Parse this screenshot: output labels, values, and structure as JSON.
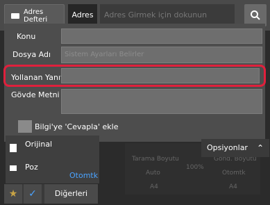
{
  "topbar": {
    "address_book_label": "Adres Defteri",
    "address_tab_label": "Adres",
    "address_placeholder": "Adres Girmek için dokunun",
    "search_icon": "search-icon"
  },
  "form": {
    "subject_label": "Konu",
    "file_name_label": "Dosya Adı",
    "file_name_placeholder": "Sistem Ayarları Belirler",
    "reply_to_label": "Yollanan Yanıt",
    "body_label": "Gövde Metni",
    "reply_checkbox_label": "Bilgi'ye 'Cevapla' ekle"
  },
  "side": {
    "original_label": "Orijinal",
    "exposure_label": "Poz",
    "exposure_value": "Otomtk"
  },
  "preview": {
    "options_label": "Opsiyonlar",
    "scan_size_label": "Tarama Boyutu",
    "scan_size_value": "Auto",
    "scan_paper": "A4",
    "ratio": "100%",
    "send_size_label": "Gönd. Boyutu",
    "send_size_value": "Otomtk",
    "send_paper": "A4"
  },
  "bottom": {
    "others_label": "Diğerleri"
  },
  "colors": {
    "highlight": "#e0203c",
    "accent_blue": "#4aa3ff",
    "star_gold": "#c9a445"
  }
}
